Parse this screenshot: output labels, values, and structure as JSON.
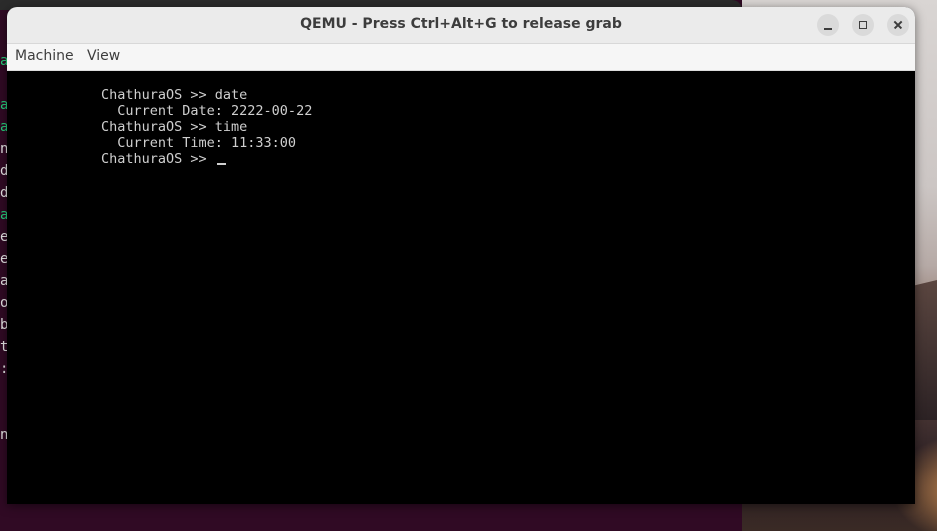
{
  "window": {
    "title": "QEMU - Press Ctrl+Alt+G to release grab"
  },
  "menu": {
    "machine": "Machine",
    "view": "View"
  },
  "console": {
    "lines": [
      "ChathuraOS >> date",
      "  Current Date: 2222-00-22",
      "ChathuraOS >> time",
      "  Current Time: 11:33:00",
      "ChathuraOS >> "
    ]
  },
  "background_terminal": {
    "visible_chars": [
      "a",
      "",
      "a",
      "a",
      "n",
      "d",
      "d",
      "a",
      "e",
      "e",
      "a",
      "o",
      "b",
      "t",
      ":",
      "",
      "",
      "n"
    ]
  },
  "colors": {
    "titlebar": "#ebebeb",
    "screen": "#000000",
    "console_text": "#cfcfcf",
    "terminal_bg": "#300a24",
    "terminal_accent": "#26d07c"
  },
  "icons": {
    "minimize": "minimize-icon",
    "maximize": "maximize-icon",
    "close": "close-icon"
  }
}
